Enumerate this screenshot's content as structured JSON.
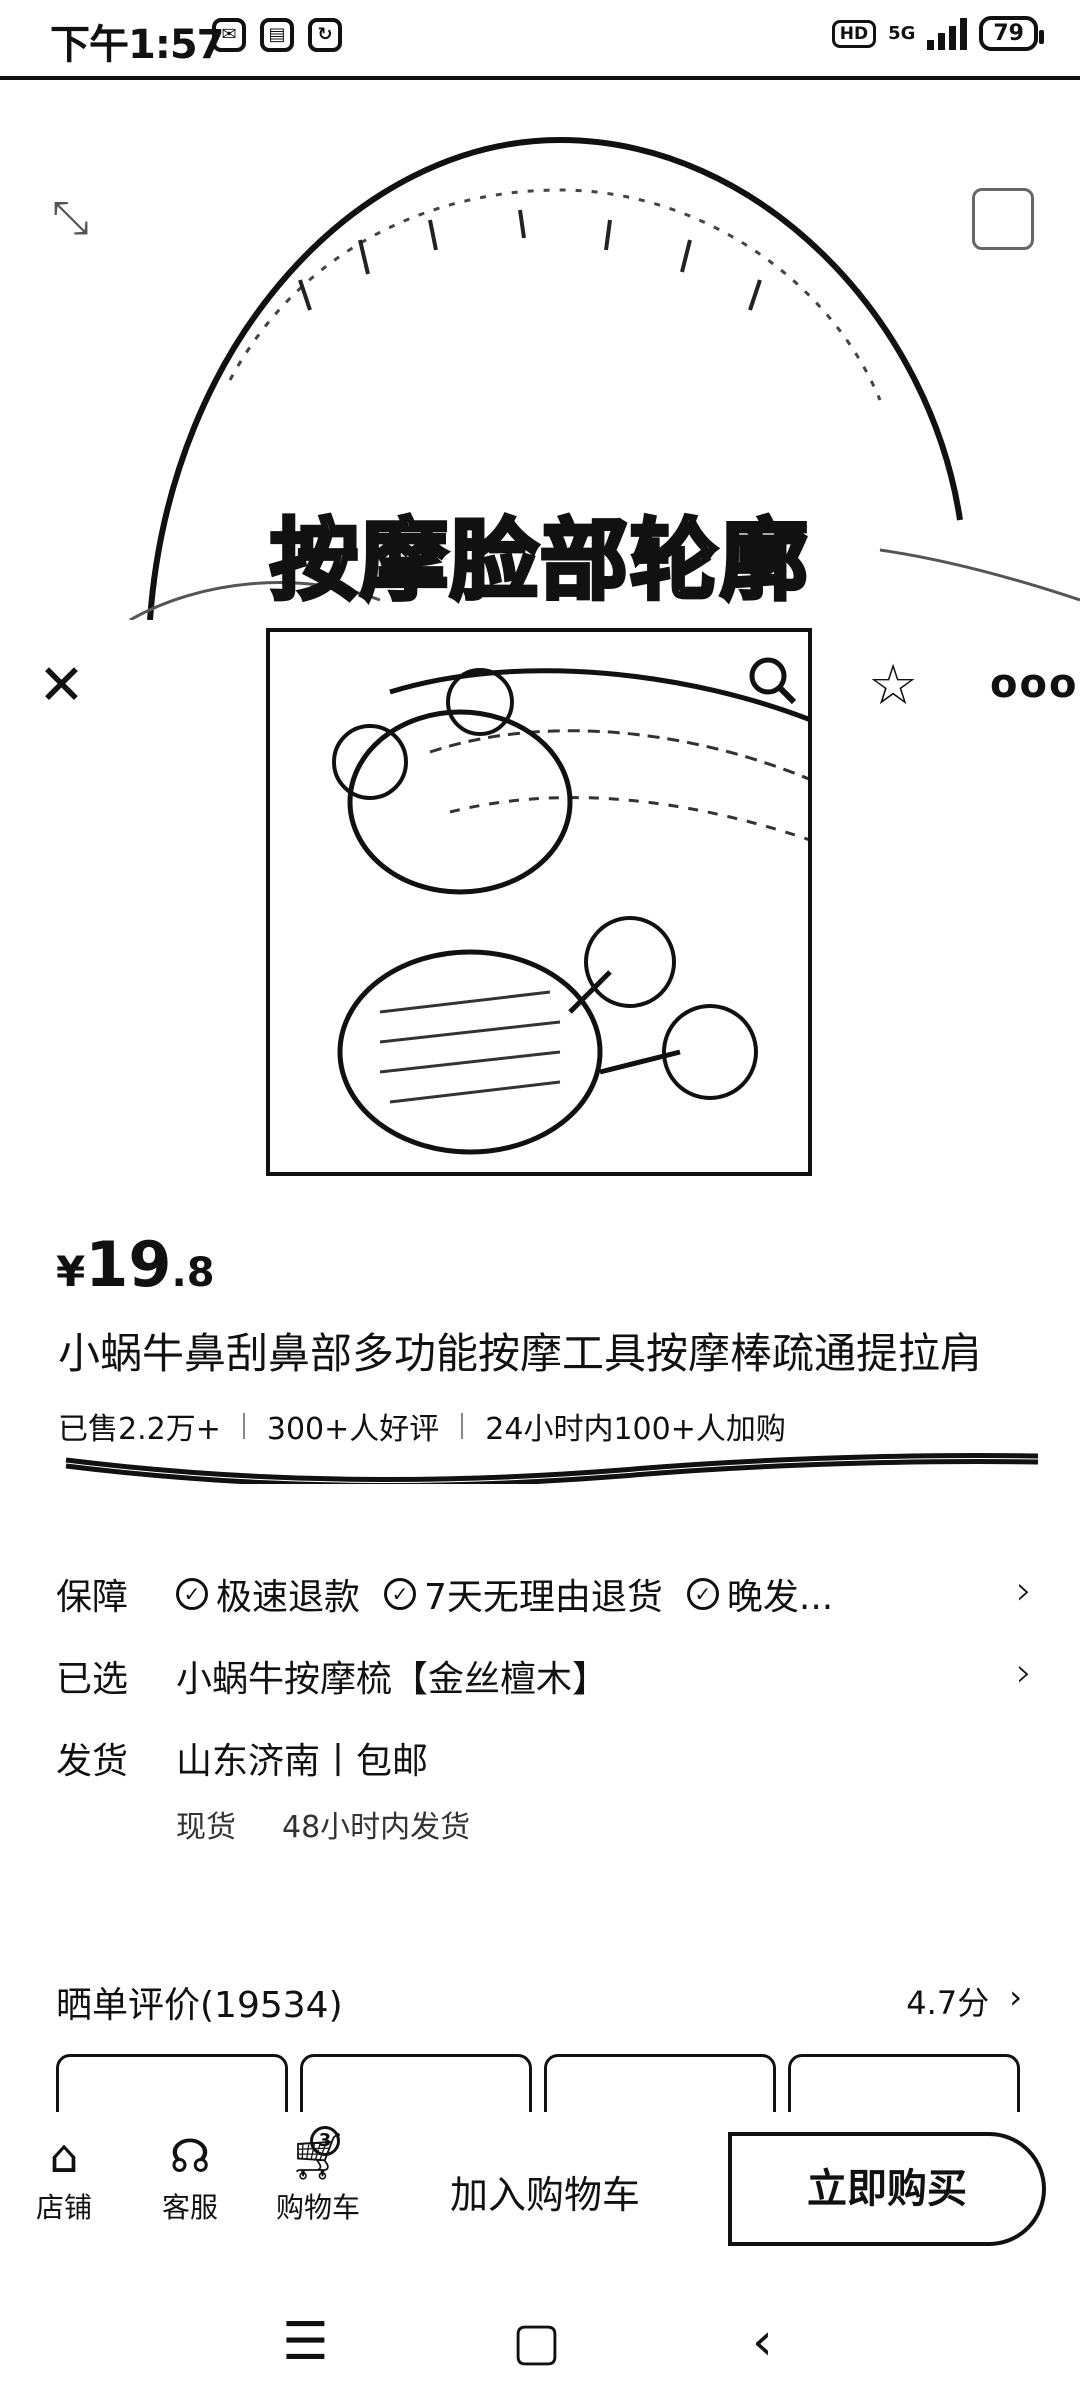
{
  "status_bar": {
    "time": "下午1:57",
    "network": "5G",
    "hd": "HD",
    "battery": "79"
  },
  "hero": {
    "caption": "按摩脸部轮廓"
  },
  "product": {
    "currency": "¥",
    "price_int": "19",
    "price_dec": ".8",
    "title": "小蜗牛鼻刮鼻部多功能按摩工具按摩棒疏通提拉肩",
    "sales": [
      "已售2.2万+",
      "300+人好评",
      "24小时内100+人加购"
    ]
  },
  "details": {
    "guarantee_label": "保障",
    "guarantees": [
      "极速退款",
      "7天无理由退货",
      "晚发..."
    ],
    "selected_label": "已选",
    "selected_value": "小蜗牛按摩梳【金丝檀木】",
    "shipping_label": "发货",
    "shipping_value": "山东济南丨包邮",
    "stock": "现货",
    "ship_time": "48小时内发货"
  },
  "reviews": {
    "title": "晒单评价(19534)",
    "score": "4.7分"
  },
  "action_bar": {
    "store": "店铺",
    "service": "客服",
    "cart": "购物车",
    "cart_count": "3",
    "add_to_cart": "加入购物车",
    "buy_now": "立即购买"
  }
}
